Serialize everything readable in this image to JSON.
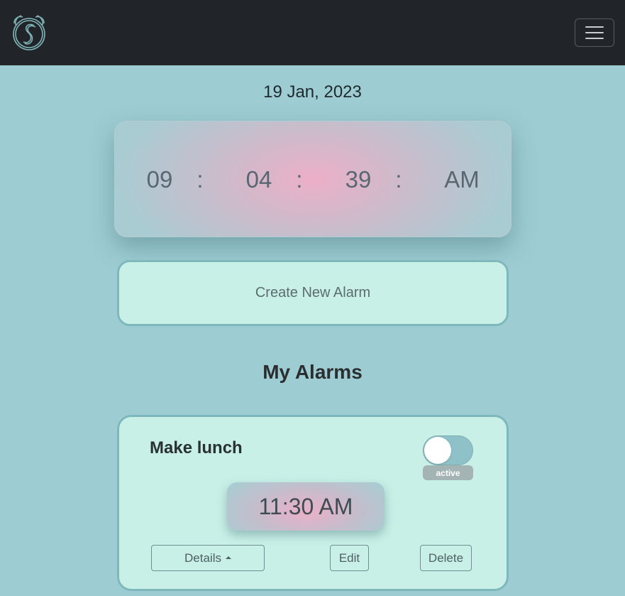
{
  "navbar": {
    "logo_icon": "alarm-clock-logo-icon",
    "menu_icon": "hamburger-menu-icon"
  },
  "date": "19 Jan, 2023",
  "clock": {
    "hours": "09",
    "minutes": "04",
    "seconds": "39",
    "period": "AM",
    "separator": ":"
  },
  "create_alarm": {
    "label": "Create New Alarm"
  },
  "alarms_section": {
    "title": "My Alarms"
  },
  "alarms": [
    {
      "name": "Make lunch",
      "time": "11:30 AM",
      "active": true,
      "status_label": "active",
      "details_label": "Details",
      "edit_label": "Edit",
      "delete_label": "Delete"
    }
  ],
  "colors": {
    "background": "#9dcdd2",
    "navbar": "#212529",
    "card": "#c9f0e7",
    "accent_pink": "#ecafc8"
  }
}
